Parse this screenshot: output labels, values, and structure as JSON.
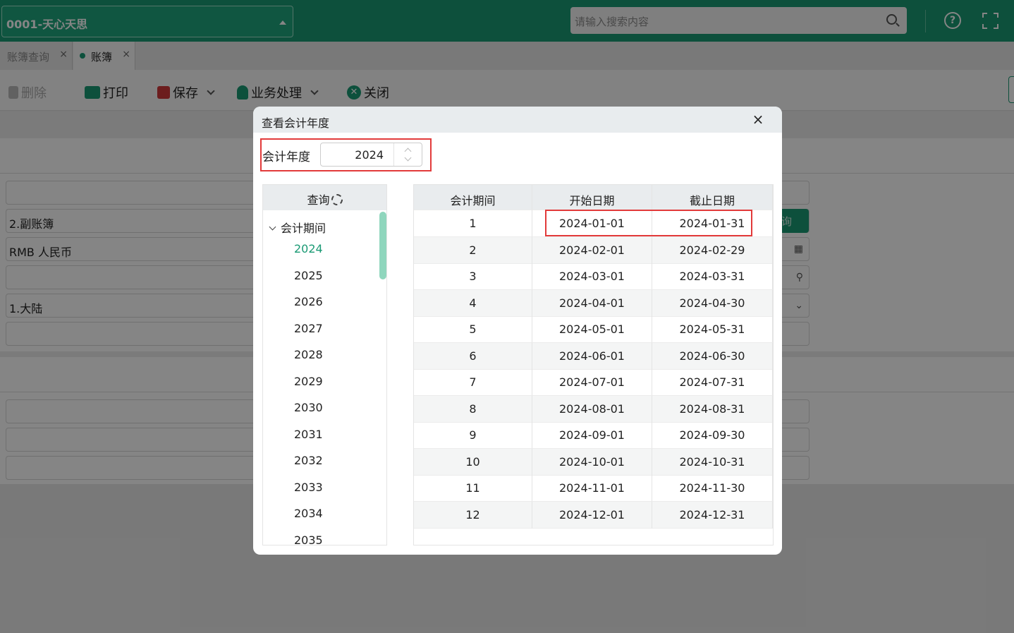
{
  "header": {
    "org": "0001-天心天思",
    "search_placeholder": "请输入搜索内容",
    "help": "?"
  },
  "tabs": [
    {
      "label": "账簿查询",
      "close": "×"
    },
    {
      "label": "账簿",
      "close": "×"
    }
  ],
  "toolbar": {
    "delete": "删除",
    "print": "打印",
    "save": "保存",
    "business": "业务处理",
    "close": "关闭"
  },
  "form": {
    "field_blank1": "",
    "field_ledger": "2.副账簿",
    "field_currency": "RMB  人民币",
    "field_blank2": "",
    "field_region": "1.大陆",
    "query_btn": "询"
  },
  "dialog": {
    "title": "查看会计年度",
    "close": "×",
    "year_label": "会计年度",
    "year_value": "2024",
    "tree": {
      "header": "查询",
      "root": "会计期间",
      "items": [
        "2024",
        "2025",
        "2026",
        "2027",
        "2028",
        "2029",
        "2030",
        "2031",
        "2032",
        "2033",
        "2034",
        "2035"
      ],
      "selected": "2024"
    },
    "grid": {
      "columns": [
        "会计期间",
        "开始日期",
        "截止日期"
      ],
      "rows": [
        [
          "1",
          "2024-01-01",
          "2024-01-31"
        ],
        [
          "2",
          "2024-02-01",
          "2024-02-29"
        ],
        [
          "3",
          "2024-03-01",
          "2024-03-31"
        ],
        [
          "4",
          "2024-04-01",
          "2024-04-30"
        ],
        [
          "5",
          "2024-05-01",
          "2024-05-31"
        ],
        [
          "6",
          "2024-06-01",
          "2024-06-30"
        ],
        [
          "7",
          "2024-07-01",
          "2024-07-31"
        ],
        [
          "8",
          "2024-08-01",
          "2024-08-31"
        ],
        [
          "9",
          "2024-09-01",
          "2024-09-30"
        ],
        [
          "10",
          "2024-10-01",
          "2024-10-31"
        ],
        [
          "11",
          "2024-11-01",
          "2024-11-30"
        ],
        [
          "12",
          "2024-12-01",
          "2024-12-31"
        ]
      ]
    }
  },
  "colors": {
    "brand_green": "#1a9a74",
    "highlight_red": "#e23a3a"
  }
}
